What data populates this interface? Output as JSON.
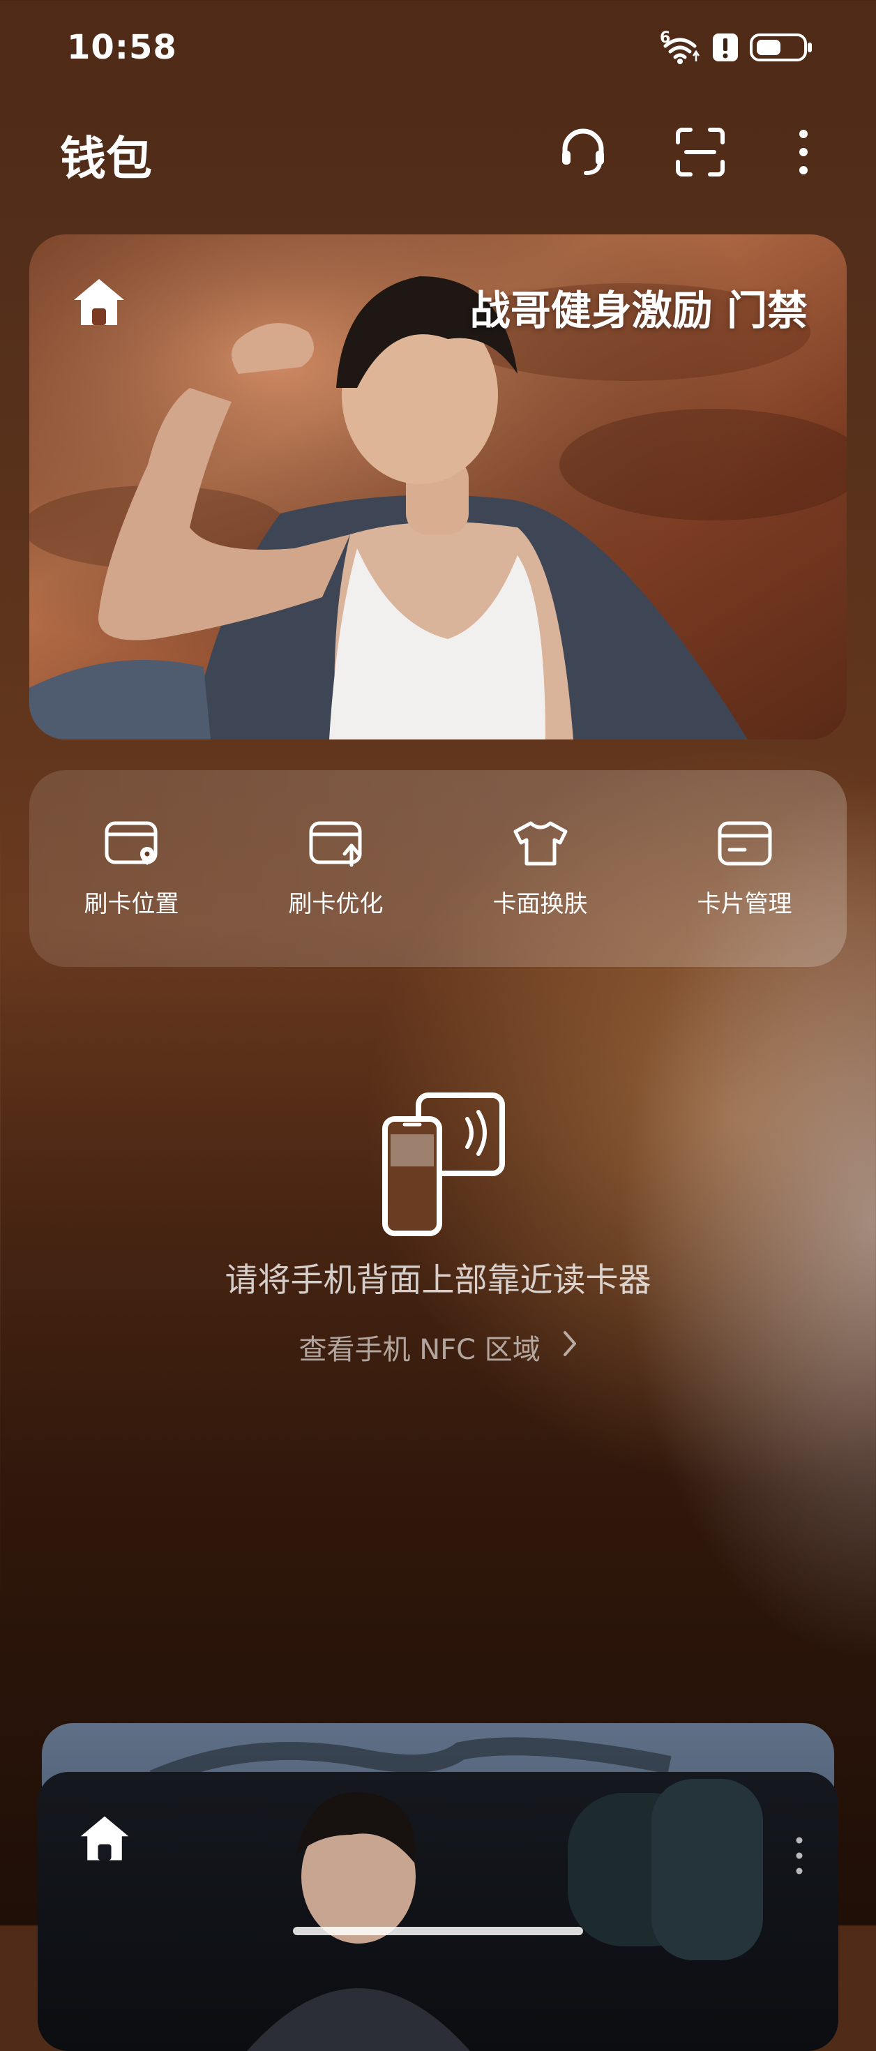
{
  "status_bar": {
    "time": "10:58",
    "icons": [
      "wifi-icon",
      "alert-icon",
      "battery-icon"
    ],
    "wifi_superscript": "6"
  },
  "header": {
    "title": "钱包",
    "buttons": [
      "headset-icon",
      "scan-icon",
      "more-icon"
    ]
  },
  "card": {
    "title": "战哥健身激励 门禁",
    "icon": "home-icon"
  },
  "actions": [
    {
      "label": "刷卡位置",
      "icon": "card-location-icon"
    },
    {
      "label": "刷卡优化",
      "icon": "card-optimize-icon"
    },
    {
      "label": "卡面换肤",
      "icon": "shirt-icon"
    },
    {
      "label": "卡片管理",
      "icon": "card-icon"
    }
  ],
  "nfc": {
    "prompt": "请将手机背面上部靠近读卡器",
    "link_label": "查看手机 NFC 区域"
  },
  "stacked_cards": {
    "front_icon": "home-icon",
    "front_menu_icon": "more-vertical-icon"
  }
}
